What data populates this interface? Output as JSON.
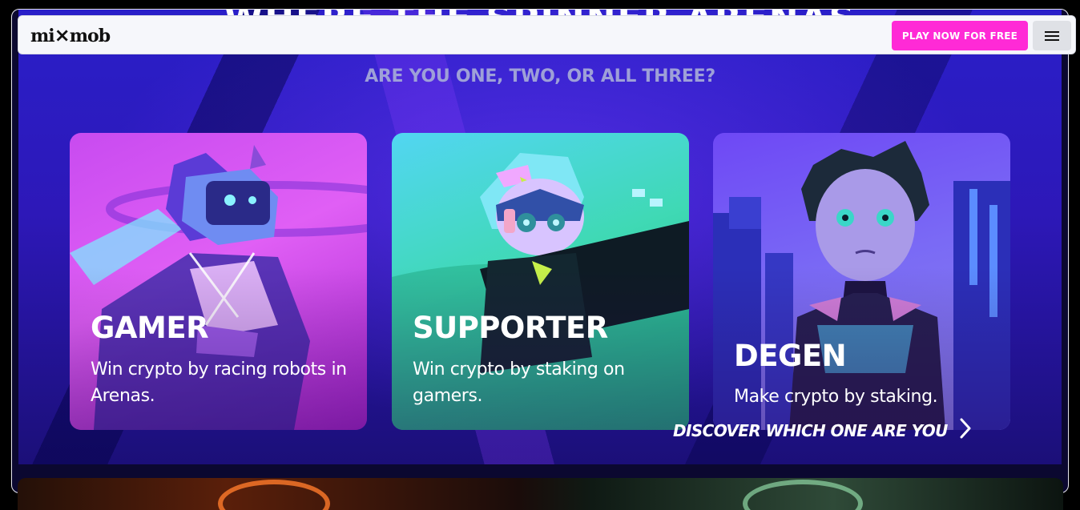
{
  "brand": {
    "logo_text_left": "mi",
    "logo_text_x": "×",
    "logo_text_right": "mob"
  },
  "hero": {
    "background_heading": "WHERE THE SPINNER ARENAS",
    "subheading": "ARE YOU ONE, TWO, OR ALL THREE?"
  },
  "nav": {
    "play_label": "PLAY NOW FOR FREE",
    "menu_icon": "hamburger-menu-icon"
  },
  "cards": [
    {
      "title": "GAMER",
      "description": "Win crypto by racing robots in Arenas."
    },
    {
      "title": "SUPPORTER",
      "description": "Win crypto by staking on gamers."
    },
    {
      "title": "DEGEN",
      "description": "Make crypto by staking."
    }
  ],
  "discover": {
    "label": "DISCOVER WHICH ONE ARE YOU",
    "icon": "chevron-right-icon"
  },
  "colors": {
    "accent": "#ff2ad6",
    "hero_bg": "#2d18b8",
    "gamer_card": "#d95af3",
    "supporter_card": "#3fd9b4",
    "degen_card": "#7a6af5"
  }
}
